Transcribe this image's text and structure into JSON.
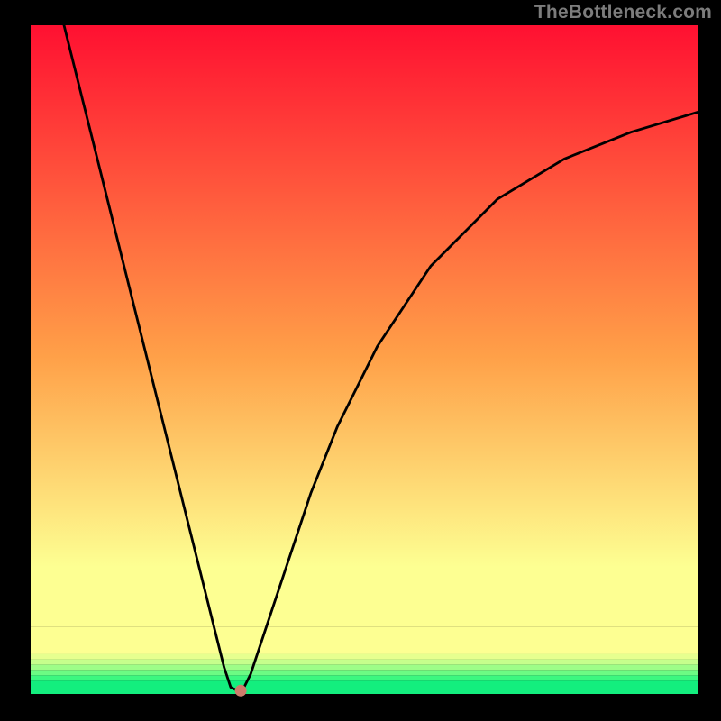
{
  "watermark": "TheBottleneck.com",
  "chart_data": {
    "type": "line",
    "title": "",
    "xlabel": "",
    "ylabel": "",
    "xlim": [
      0,
      100
    ],
    "ylim": [
      0,
      100
    ],
    "series": [
      {
        "name": "curve",
        "x": [
          5,
          8,
          12,
          16,
          20,
          24,
          26,
          28,
          29,
          30,
          31,
          32,
          33,
          34,
          36,
          38,
          42,
          46,
          52,
          60,
          70,
          80,
          90,
          100
        ],
        "y": [
          100,
          88,
          72,
          56,
          40,
          24,
          16,
          8,
          4,
          1,
          0.5,
          1,
          3,
          6,
          12,
          18,
          30,
          40,
          52,
          64,
          74,
          80,
          84,
          87
        ]
      }
    ],
    "marker": {
      "x": 31.5,
      "y": 0.5
    },
    "background_bands": [
      {
        "y0": 0.0,
        "y1": 2.0,
        "color": "#13ee7e"
      },
      {
        "y0": 2.0,
        "y1": 2.8,
        "color": "#3cf780"
      },
      {
        "y0": 2.8,
        "y1": 3.6,
        "color": "#6cfb84"
      },
      {
        "y0": 3.6,
        "y1": 4.4,
        "color": "#9dfd88"
      },
      {
        "y0": 4.4,
        "y1": 5.2,
        "color": "#c6fe8c"
      },
      {
        "y0": 5.2,
        "y1": 6.0,
        "color": "#e6ff8f"
      },
      {
        "y0": 6.0,
        "y1": 10.0,
        "color": "#fdff92"
      }
    ],
    "gradient_top": "#ff1031",
    "gradient_mid": "#ffa048",
    "gradient_low": "#fdff92"
  }
}
